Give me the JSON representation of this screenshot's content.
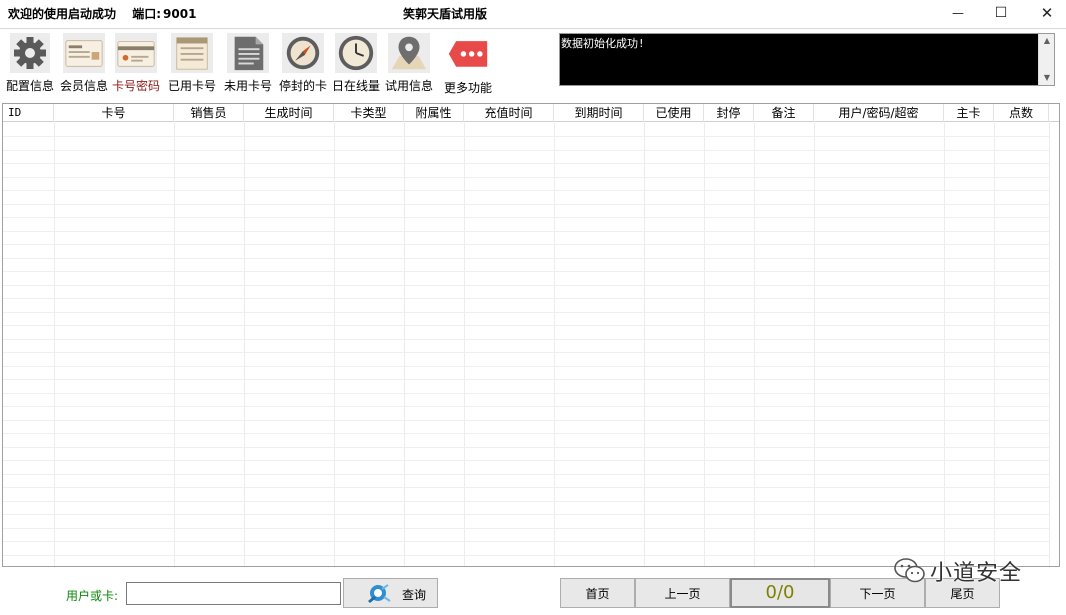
{
  "titlebar": {
    "welcome": "欢迎的使用启动成功",
    "port_label": "端口:",
    "port_value": "9001",
    "app_title": "笑郭天盾试用版",
    "minimize": "—",
    "maximize": "☐",
    "close": "✕"
  },
  "toolbar": {
    "items": [
      {
        "label": "配置信息",
        "icon": "gear-icon"
      },
      {
        "label": "会员信息",
        "icon": "member-card-icon"
      },
      {
        "label": "卡号密码",
        "icon": "card-password-icon"
      },
      {
        "label": "已用卡号",
        "icon": "used-card-icon"
      },
      {
        "label": "未用卡号",
        "icon": "unused-card-icon"
      },
      {
        "label": "停封的卡",
        "icon": "compass-icon"
      },
      {
        "label": "日在线量",
        "icon": "clock-icon"
      },
      {
        "label": "试用信息",
        "icon": "location-pin-icon"
      },
      {
        "label": "更多功能",
        "icon": "more-tag-icon"
      }
    ]
  },
  "console": {
    "text": "数据初始化成功!"
  },
  "table": {
    "columns": [
      "ID",
      "卡号",
      "销售员",
      "生成时间",
      "卡类型",
      "附属性",
      "充值时间",
      "到期时间",
      "已使用",
      "封停",
      "备注",
      "用户/密码/超密",
      "主卡",
      "点数"
    ],
    "rows": []
  },
  "query": {
    "label": "用户或卡:",
    "value": "",
    "button": "查询"
  },
  "pager": {
    "first": "首页",
    "prev": "上一页",
    "count": "0/0",
    "next": "下一页",
    "last": "尾页"
  },
  "watermark": {
    "text": "小道安全"
  },
  "colors": {
    "console_bg": "#000000",
    "query_label": "#0a8a0a",
    "pager_count": "#808000",
    "card_password_label": "#8b1a1a"
  }
}
